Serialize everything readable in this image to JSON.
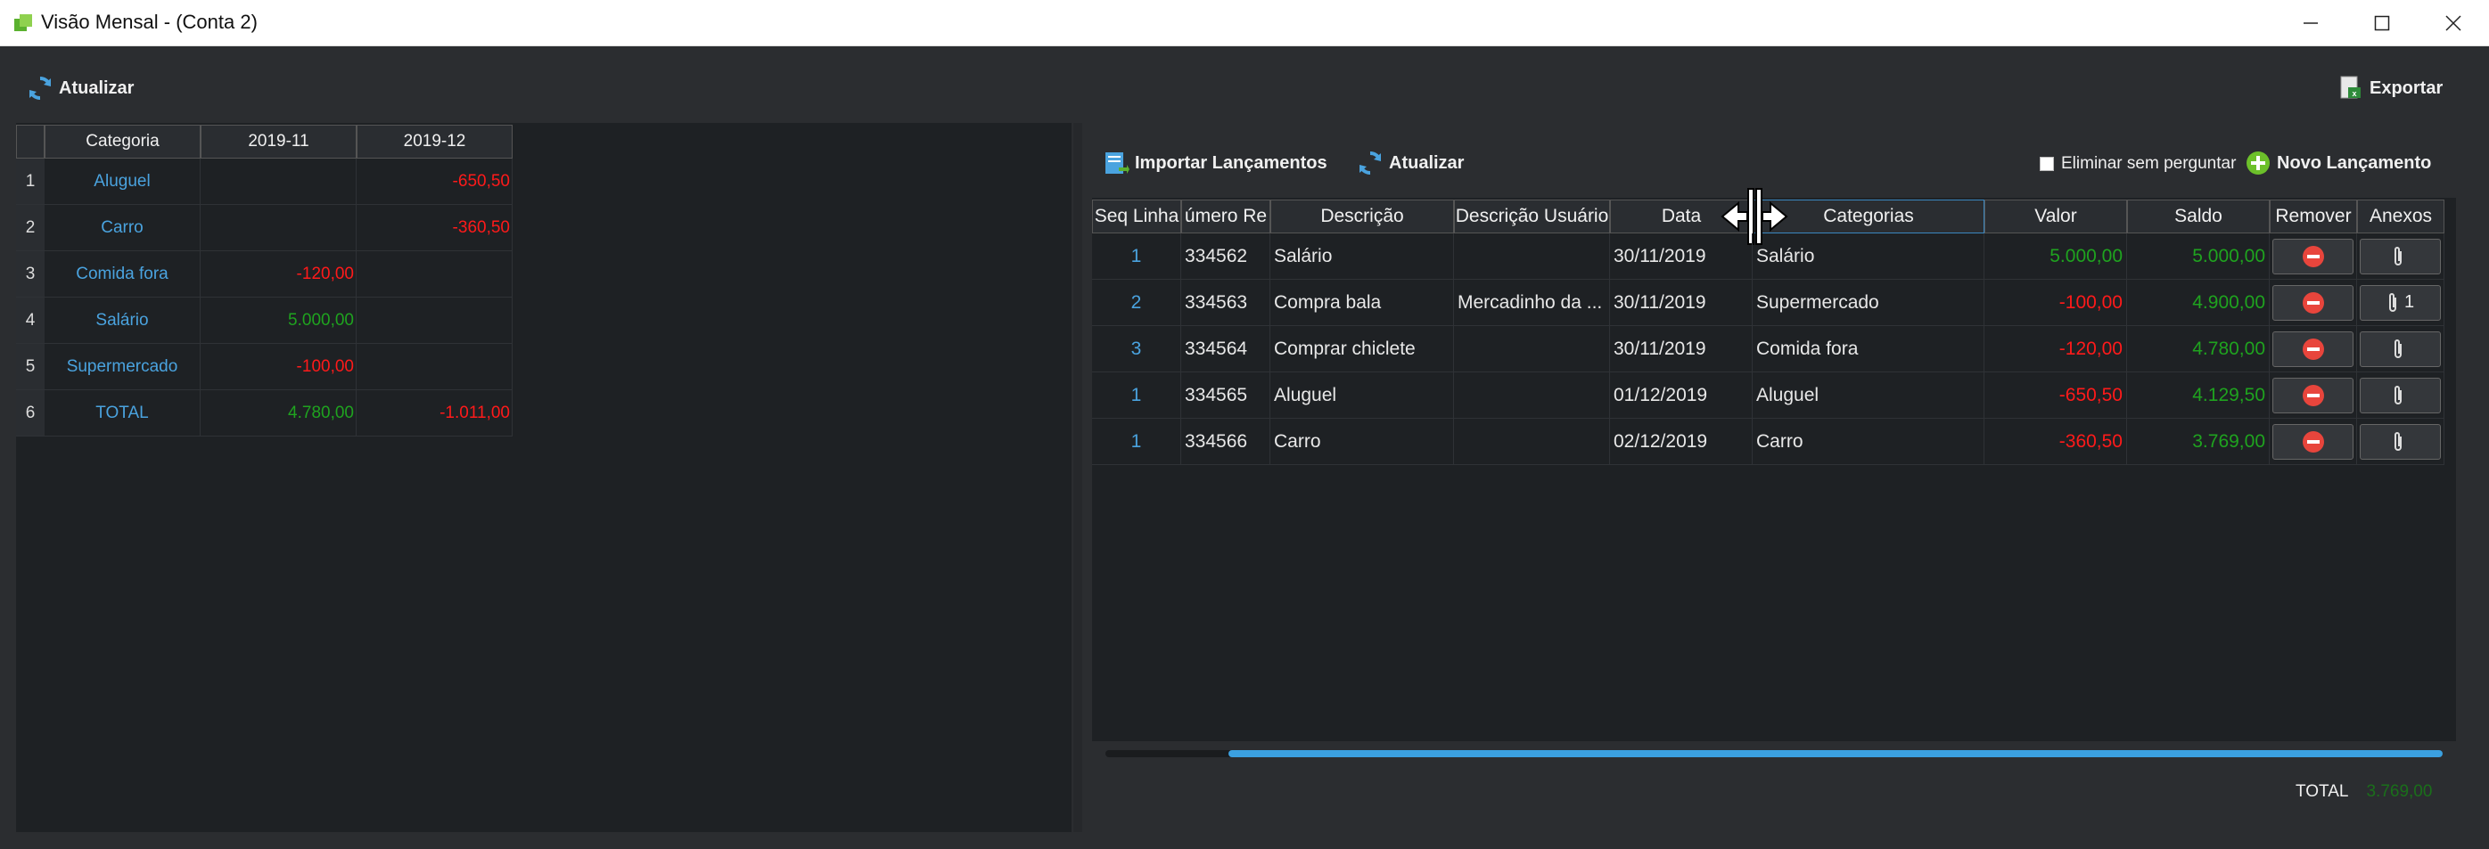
{
  "window": {
    "title": "Visão Mensal - (Conta 2)"
  },
  "toolbar": {
    "refresh_label": "Atualizar",
    "export_label": "Exportar"
  },
  "pivot": {
    "headers": [
      "Categoria",
      "2019-11",
      "2019-12"
    ],
    "rows": [
      {
        "num": "1",
        "category": "Aluguel",
        "v1": "",
        "v2": "-650,50"
      },
      {
        "num": "2",
        "category": "Carro",
        "v1": "",
        "v2": "-360,50"
      },
      {
        "num": "3",
        "category": "Comida fora",
        "v1": "-120,00",
        "v2": ""
      },
      {
        "num": "4",
        "category": "Salário",
        "v1": "5.000,00",
        "v2": ""
      },
      {
        "num": "5",
        "category": "Supermercado",
        "v1": "-100,00",
        "v2": ""
      },
      {
        "num": "6",
        "category": "TOTAL",
        "v1": "4.780,00",
        "v2": "-1.011,00"
      }
    ]
  },
  "entries_toolbar": {
    "import_label": "Importar Lançamentos",
    "refresh_label": "Atualizar",
    "delete_no_ask_label": "Eliminar sem perguntar",
    "new_entry_label": "Novo Lançamento"
  },
  "entries": {
    "headers": [
      "Seq Linha",
      "úmero Re",
      "Descrição",
      "Descrição Usuário",
      "Data",
      "Categorias",
      "Valor",
      "Saldo",
      "Remover",
      "Anexos"
    ],
    "rows": [
      {
        "seq": "1",
        "num": "334562",
        "desc": "Salário",
        "user_desc": "",
        "date": "30/11/2019",
        "category": "Salário",
        "value": "5.000,00",
        "balance": "5.000,00",
        "attachments": ""
      },
      {
        "seq": "2",
        "num": "334563",
        "desc": "Compra bala",
        "user_desc": "Mercadinho da ...",
        "date": "30/11/2019",
        "category": "Supermercado",
        "value": "-100,00",
        "balance": "4.900,00",
        "attachments": "1"
      },
      {
        "seq": "3",
        "num": "334564",
        "desc": "Comprar chiclete",
        "user_desc": "",
        "date": "30/11/2019",
        "category": "Comida fora",
        "value": "-120,00",
        "balance": "4.780,00",
        "attachments": ""
      },
      {
        "seq": "1",
        "num": "334565",
        "desc": "Aluguel",
        "user_desc": "",
        "date": "01/12/2019",
        "category": "Aluguel",
        "value": "-650,50",
        "balance": "4.129,50",
        "attachments": ""
      },
      {
        "seq": "1",
        "num": "334566",
        "desc": "Carro",
        "user_desc": "",
        "date": "02/12/2019",
        "category": "Carro",
        "value": "-360,50",
        "balance": "3.769,00",
        "attachments": ""
      }
    ]
  },
  "footer": {
    "total_label": "TOTAL",
    "total_value": "3.769,00"
  },
  "colors": {
    "positive": "#1fa31f",
    "negative": "#ff1a1a",
    "link": "#4aa3df",
    "scroll": "#3ba0e0"
  }
}
